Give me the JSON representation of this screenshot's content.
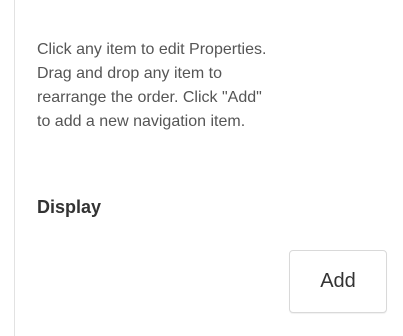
{
  "help": {
    "text": "Click any item to edit Properties.\nDrag and drop any item to\nrearrange the order. Click \"Add\"\nto add a new navigation item."
  },
  "section": {
    "title": "Display"
  },
  "actions": {
    "add_label": "Add"
  }
}
